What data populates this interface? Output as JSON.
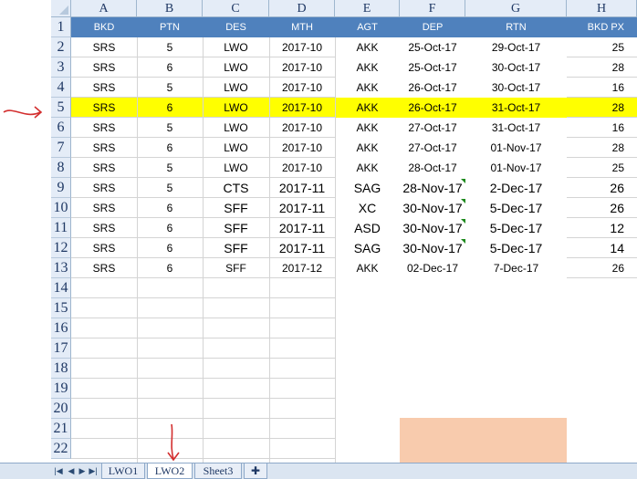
{
  "column_headers": [
    "A",
    "B",
    "C",
    "D",
    "E",
    "F",
    "G",
    "H"
  ],
  "row_numbers": [
    "1",
    "2",
    "3",
    "4",
    "5",
    "6",
    "7",
    "8",
    "9",
    "10",
    "11",
    "12",
    "13",
    "14",
    "15",
    "16",
    "17",
    "18",
    "19",
    "20",
    "21",
    "22"
  ],
  "table": {
    "headers": [
      "BKD",
      "PTN",
      "DES",
      "MTH",
      "AGT",
      "DEP",
      "RTN",
      "BKD PX"
    ],
    "rows": [
      [
        "SRS",
        "5",
        "LWO",
        "2017-10",
        "AKK",
        "25-Oct-17",
        "29-Oct-17",
        "25"
      ],
      [
        "SRS",
        "6",
        "LWO",
        "2017-10",
        "AKK",
        "25-Oct-17",
        "30-Oct-17",
        "28"
      ],
      [
        "SRS",
        "5",
        "LWO",
        "2017-10",
        "AKK",
        "26-Oct-17",
        "30-Oct-17",
        "16"
      ],
      [
        "SRS",
        "6",
        "LWO",
        "2017-10",
        "AKK",
        "26-Oct-17",
        "31-Oct-17",
        "28"
      ],
      [
        "SRS",
        "5",
        "LWO",
        "2017-10",
        "AKK",
        "27-Oct-17",
        "31-Oct-17",
        "16"
      ],
      [
        "SRS",
        "6",
        "LWO",
        "2017-10",
        "AKK",
        "27-Oct-17",
        "01-Nov-17",
        "28"
      ],
      [
        "SRS",
        "5",
        "LWO",
        "2017-10",
        "AKK",
        "28-Oct-17",
        "01-Nov-17",
        "25"
      ],
      [
        "SRS",
        "5",
        "CTS",
        "2017-11",
        "SAG",
        "28-Nov-17",
        "2-Dec-17",
        "26"
      ],
      [
        "SRS",
        "6",
        "SFF",
        "2017-11",
        "XC",
        "30-Nov-17",
        "5-Dec-17",
        "26"
      ],
      [
        "SRS",
        "6",
        "SFF",
        "2017-11",
        "ASD",
        "30-Nov-17",
        "5-Dec-17",
        "12"
      ],
      [
        "SRS",
        "6",
        "SFF",
        "2017-11",
        "SAG",
        "30-Nov-17",
        "5-Dec-17",
        "14"
      ],
      [
        "SRS",
        "6",
        "SFF",
        "2017-12",
        "AKK",
        "02-Dec-17",
        "7-Dec-17",
        "26"
      ]
    ]
  },
  "highlighted_row": "5",
  "tabs": [
    {
      "label": "LWO1",
      "active": false
    },
    {
      "label": "LWO2",
      "active": true
    },
    {
      "label": "Sheet3",
      "active": false
    }
  ],
  "colors": {
    "header_fill": "#4f81bd",
    "highlight": "#ffff00",
    "annotation_arrow": "#d32f2f",
    "peach_fill": "#f8cbad"
  }
}
